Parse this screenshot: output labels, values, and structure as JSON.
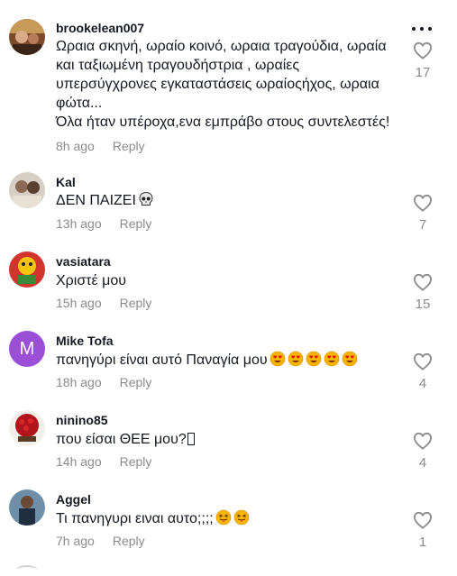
{
  "comments": [
    {
      "username": "brookelean007",
      "text_lines": [
        "Ωραια σκηνή, ωραίο κοινό, ωραια τραγούδια, ωραία",
        "και ταξιωμένη τραγουδήστρια , ωραίες",
        "υπερσύγχρονες εγκαταστάσεις ωραίοςήχος, ωραια",
        "φώτα...",
        "Όλα ήταν υπέροχα,ενα εμπράβο στους συντελεστές!"
      ],
      "time": "8h ago",
      "reply": "Reply",
      "likes": "17"
    },
    {
      "username": "Kal",
      "text": "ΔΕΝ ΠΑΙΖΕΙ",
      "emoji": "skull",
      "time": "13h ago",
      "reply": "Reply",
      "likes": "7"
    },
    {
      "username": "vasiatara",
      "text": "Χριστέ μου",
      "time": "15h ago",
      "reply": "Reply",
      "likes": "15"
    },
    {
      "username": "Mike Tofa",
      "avatar_letter": "M",
      "avatar_color": "#9a4fd6",
      "text": "πανηγύρι είναι αυτό Παναγία μου",
      "emoji": "heart-eyes x5",
      "time": "18h ago",
      "reply": "Reply",
      "likes": "4"
    },
    {
      "username": "ninino85",
      "text": "που είσαι ΘΕΕ μου?",
      "time": "14h ago",
      "reply": "Reply",
      "likes": "4"
    },
    {
      "username": "Aggel",
      "text": "Τι πανηγυρι ειναι αυτο;;;;",
      "emoji": "tongue-wink x2",
      "time": "7h ago",
      "reply": "Reply",
      "likes": "1"
    }
  ],
  "icons": {
    "like": "heart-outline-icon",
    "more": "more-dots-icon"
  },
  "colors": {
    "text": "#161823",
    "muted": "#8a8b91"
  }
}
